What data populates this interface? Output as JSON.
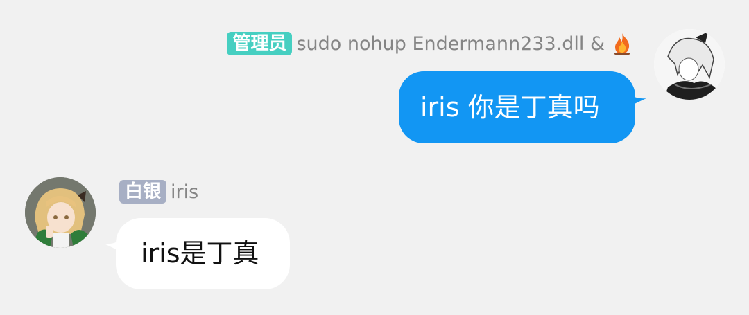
{
  "messages": [
    {
      "direction": "outgoing",
      "badge": "管理员",
      "badge_color": "#46cfc1",
      "sender": "sudo nohup Endermann233.dll &",
      "sender_icon": "fire-icon",
      "text": "iris 你是丁真吗",
      "bubble_color": "#1296f3",
      "text_color": "#ffffff"
    },
    {
      "direction": "incoming",
      "badge": "白银",
      "badge_color": "#a7afc4",
      "sender": "iris",
      "text": "iris是丁真",
      "bubble_color": "#ffffff",
      "text_color": "#111111"
    }
  ],
  "background": "#f1f1f1"
}
